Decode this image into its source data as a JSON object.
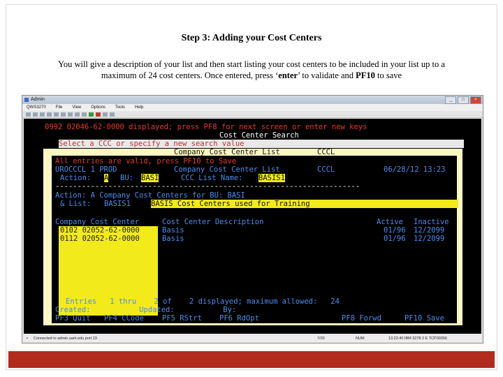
{
  "slide": {
    "heading": "Step 3:  Adding your Cost Centers",
    "description_line1": "You will give a description of your list and then start listing your cost centers to be included in your list up to a",
    "description_line2_a": "maximum of 24 cost centers.  Once entered, press ‘",
    "description_line2_enter": "enter",
    "description_line2_b": "’ to validate and ",
    "description_line2_pf10": "PF10",
    "description_line2_c": " to save"
  },
  "window": {
    "title": "Admin",
    "controls": [
      "_",
      "□",
      "×"
    ],
    "menu": [
      "QWS3270",
      "File",
      "View",
      "Options",
      "Tools",
      "Help"
    ]
  },
  "terminal": {
    "bg_line1": "0992 02046-62-0000 displayed; press PF8 for next screen or enter new keys",
    "bg_title": "Cost Center Search",
    "bg_prompt": "Select a CCC or specify a new search value",
    "popup_title": "Company Cost Center List",
    "popup_code": "CCCL",
    "msg_valid": "All entries are valid, press PF10 to Save",
    "screen_id": "UROCCCL 1 PROD",
    "header_title": "Company Cost Center List",
    "header_code": "CCCL",
    "header_datetime": "06/28/12 13:23",
    "action_label": "Action:",
    "action_value": "A",
    "bu_label": "BU:",
    "bu_value": "BASI",
    "list_name_label": "CCC List Name:",
    "list_name_value": "BASIS1",
    "divider": "---------------------------------------------------------------------",
    "action_desc": "Action: A Company Cost Centers for BU: BASI",
    "list_label": "& List:",
    "list_value": "BASIS1",
    "list_desc": "BASIS Cost Centers used for Training",
    "col_ccc": "Company Cost Center",
    "col_desc": "Cost Center Description",
    "col_active": "Active",
    "col_inactive": "Inactive",
    "rows": [
      {
        "ccc": "0102 02052-62-0000",
        "desc": "Basis",
        "active": "01/96",
        "inactive": "12/2099"
      },
      {
        "ccc": "0112 02052-62-0000",
        "desc": "Basis",
        "active": "01/96",
        "inactive": "12/2099"
      }
    ],
    "entries_line": "Entries   1 thru    2 of    2 displayed; maximum allowed:   24",
    "created_line": "Created:           Updated:           By:",
    "pf3": "PF3 Quit",
    "pf4": "PF4 CCode",
    "pf5": "PF5 RStrt",
    "pf6": "PF6 RdOpt",
    "pf8": "PF8 Forwd",
    "pf10": "PF10 Save"
  },
  "statusbar": {
    "connection": "Connected to admin.uark.edu port 23",
    "cursor": "7/20",
    "numlock": "NUM",
    "session": "13:22:40  IBM 3278 2 E   TCP00356"
  },
  "colors": {
    "accent_bar": "#b22b1d",
    "terminal_bg": "#000000",
    "terminal_red": "#e23a2e",
    "terminal_blue": "#4a8df0",
    "highlight_yellow": "#f2ea1a"
  }
}
